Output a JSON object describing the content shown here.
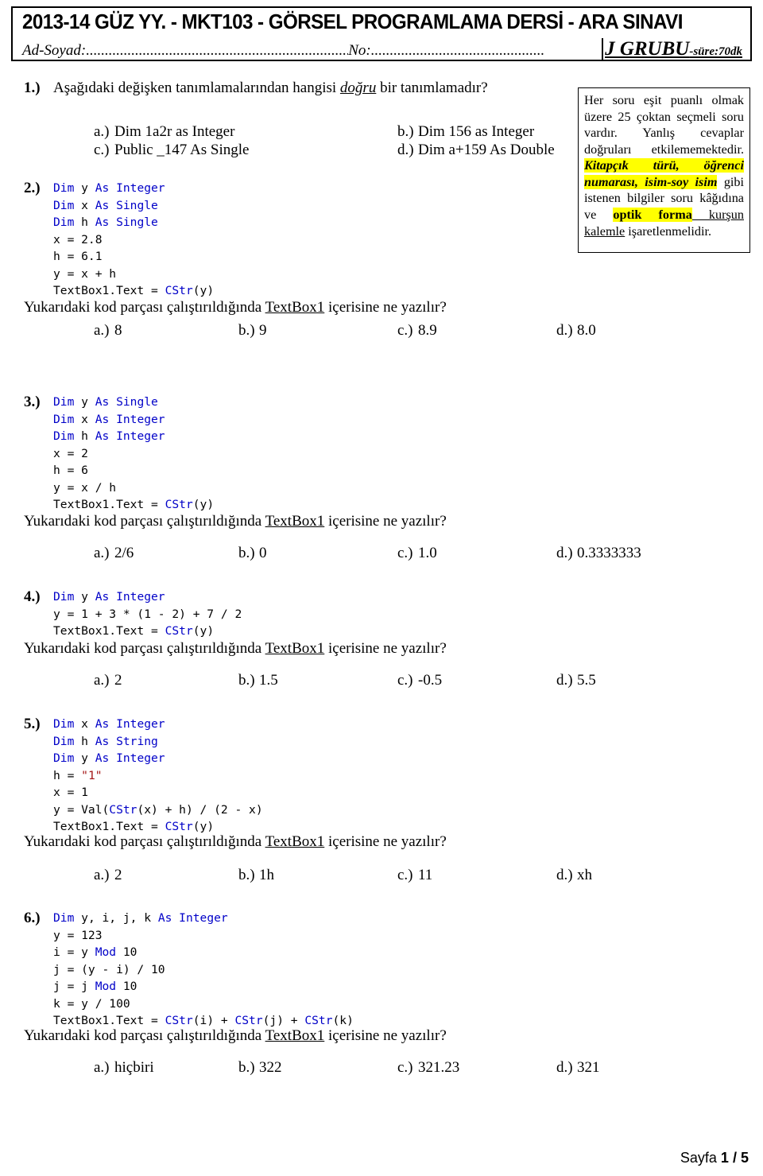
{
  "header": {
    "title": "2013-14 GÜZ YY. - MKT103 - GÖRSEL PROGRAMLAMA DERSİ - ARA SINAVI",
    "name_label": "Ad-Soyad:",
    "name_dots": "......................................................................",
    "no_label": "No:",
    "no_dots": "..............................................",
    "group": "J GRUBU",
    "duration": "-süre:70dk"
  },
  "info_box": {
    "line1": "Her soru eşit puanlı olmak üzere 25 çoktan seçmeli soru vardır.",
    "line2": "Yanlış cevaplar doğruları etkilememektedir.",
    "hl1": "Kitapçık türü, öğrenci numarası, isim-soy isim",
    "mid": " gibi istenen bilgiler soru kâğıdına ve ",
    "hl2": "optik forma",
    "underlined": " kurşun kalemle",
    "tail": " işaretlenmelidir."
  },
  "questions": [
    {
      "num": "1.)",
      "prompt_pre": "Aşağıdaki değişken tanımlamalarından hangisi ",
      "prompt_em": "doğru",
      "prompt_post": " bir tanımlamadır?",
      "options": [
        {
          "key": "a.)",
          "text": "Dim 1a2r as Integer"
        },
        {
          "key": "b.)",
          "text": "Dim 156 as Integer"
        },
        {
          "key": "c.)",
          "text": "Public _147 As Single"
        },
        {
          "key": "d.)",
          "text": "Dim a+159 As Double"
        }
      ]
    },
    {
      "num": "2.)",
      "code_lines": [
        [
          {
            "t": "Dim ",
            "c": "kw"
          },
          {
            "t": "y ",
            "c": "n"
          },
          {
            "t": "As Integer",
            "c": "kw"
          }
        ],
        [
          {
            "t": "Dim ",
            "c": "kw"
          },
          {
            "t": "x ",
            "c": "n"
          },
          {
            "t": "As Single",
            "c": "kw"
          }
        ],
        [
          {
            "t": "Dim ",
            "c": "kw"
          },
          {
            "t": "h ",
            "c": "n"
          },
          {
            "t": "As Single",
            "c": "kw"
          }
        ],
        [
          {
            "t": "x = 2.8",
            "c": "n"
          }
        ],
        [
          {
            "t": "h = 6.1",
            "c": "n"
          }
        ],
        [
          {
            "t": "y = x + h",
            "c": "n"
          }
        ],
        [
          {
            "t": "TextBox1.Text = ",
            "c": "n"
          },
          {
            "t": "CStr",
            "c": "kw"
          },
          {
            "t": "(y)",
            "c": "n"
          }
        ]
      ],
      "ask_pre": "Yukarıdaki kod parçası çalıştırıldığında ",
      "ask_em": "TextBox1",
      "ask_post": " içerisine ne yazılır?",
      "options": [
        {
          "key": "a.)",
          "text": "8"
        },
        {
          "key": "b.)",
          "text": "9"
        },
        {
          "key": "c.)",
          "text": "8.9"
        },
        {
          "key": "d.)",
          "text": "8.0"
        }
      ]
    },
    {
      "num": "3.)",
      "code_lines": [
        [
          {
            "t": "Dim ",
            "c": "kw"
          },
          {
            "t": "y ",
            "c": "n"
          },
          {
            "t": "As Single",
            "c": "kw"
          }
        ],
        [
          {
            "t": "Dim ",
            "c": "kw"
          },
          {
            "t": "x ",
            "c": "n"
          },
          {
            "t": "As Integer",
            "c": "kw"
          }
        ],
        [
          {
            "t": "Dim ",
            "c": "kw"
          },
          {
            "t": "h ",
            "c": "n"
          },
          {
            "t": "As Integer",
            "c": "kw"
          }
        ],
        [
          {
            "t": "x = 2",
            "c": "n"
          }
        ],
        [
          {
            "t": "h = 6",
            "c": "n"
          }
        ],
        [
          {
            "t": "y = x / h",
            "c": "n"
          }
        ],
        [
          {
            "t": "TextBox1.Text = ",
            "c": "n"
          },
          {
            "t": "CStr",
            "c": "kw"
          },
          {
            "t": "(y)",
            "c": "n"
          }
        ]
      ],
      "ask_pre": "Yukarıdaki kod parçası çalıştırıldığında ",
      "ask_em": "TextBox1",
      "ask_post": " içerisine ne yazılır?",
      "options": [
        {
          "key": "a.)",
          "text": "2/6"
        },
        {
          "key": "b.)",
          "text": "0"
        },
        {
          "key": "c.)",
          "text": "1.0"
        },
        {
          "key": "d.)",
          "text": "0.3333333"
        }
      ]
    },
    {
      "num": "4.)",
      "code_lines": [
        [
          {
            "t": "Dim ",
            "c": "kw"
          },
          {
            "t": "y ",
            "c": "n"
          },
          {
            "t": "As Integer",
            "c": "kw"
          }
        ],
        [
          {
            "t": "y = 1 + 3 * (1 - 2) + 7 / 2",
            "c": "n"
          }
        ],
        [
          {
            "t": "TextBox1.Text = ",
            "c": "n"
          },
          {
            "t": "CStr",
            "c": "kw"
          },
          {
            "t": "(y)",
            "c": "n"
          }
        ]
      ],
      "ask_pre": "Yukarıdaki kod parçası çalıştırıldığında ",
      "ask_em": "TextBox1",
      "ask_post": " içerisine ne yazılır?",
      "options": [
        {
          "key": "a.)",
          "text": "2"
        },
        {
          "key": "b.)",
          "text": "1.5"
        },
        {
          "key": "c.)",
          "text": "-0.5"
        },
        {
          "key": "d.)",
          "text": "5.5"
        }
      ]
    },
    {
      "num": "5.)",
      "code_lines": [
        [
          {
            "t": "Dim ",
            "c": "kw"
          },
          {
            "t": "x ",
            "c": "n"
          },
          {
            "t": "As Integer",
            "c": "kw"
          }
        ],
        [
          {
            "t": "Dim ",
            "c": "kw"
          },
          {
            "t": "h ",
            "c": "n"
          },
          {
            "t": "As String",
            "c": "kw"
          }
        ],
        [
          {
            "t": "Dim ",
            "c": "kw"
          },
          {
            "t": "y ",
            "c": "n"
          },
          {
            "t": "As Integer",
            "c": "kw"
          }
        ],
        [
          {
            "t": "h = ",
            "c": "n"
          },
          {
            "t": "\"1\"",
            "c": "str"
          }
        ],
        [
          {
            "t": "x = 1",
            "c": "n"
          }
        ],
        [
          {
            "t": "y = Val(",
            "c": "n"
          },
          {
            "t": "CStr",
            "c": "kw"
          },
          {
            "t": "(x) + h) / (2 - x)",
            "c": "n"
          }
        ],
        [
          {
            "t": "TextBox1.Text = ",
            "c": "n"
          },
          {
            "t": "CStr",
            "c": "kw"
          },
          {
            "t": "(y)",
            "c": "n"
          }
        ]
      ],
      "ask_pre": "Yukarıdaki kod parçası çalıştırıldığında ",
      "ask_em": "TextBox1",
      "ask_post": " içerisine ne yazılır?",
      "options": [
        {
          "key": "a.)",
          "text": "2"
        },
        {
          "key": "b.)",
          "text": "1h"
        },
        {
          "key": "c.)",
          "text": "11"
        },
        {
          "key": "d.)",
          "text": "xh"
        }
      ]
    },
    {
      "num": "6.)",
      "code_lines": [
        [
          {
            "t": "Dim ",
            "c": "kw"
          },
          {
            "t": "y, i, j, k ",
            "c": "n"
          },
          {
            "t": "As Integer",
            "c": "kw"
          }
        ],
        [
          {
            "t": "y = 123",
            "c": "n"
          }
        ],
        [
          {
            "t": "i = y ",
            "c": "n"
          },
          {
            "t": "Mod",
            "c": "kw"
          },
          {
            "t": " 10",
            "c": "n"
          }
        ],
        [
          {
            "t": "j = (y - i) / 10",
            "c": "n"
          }
        ],
        [
          {
            "t": "j = j ",
            "c": "n"
          },
          {
            "t": "Mod",
            "c": "kw"
          },
          {
            "t": " 10",
            "c": "n"
          }
        ],
        [
          {
            "t": "k = y / 100",
            "c": "n"
          }
        ],
        [
          {
            "t": "TextBox1.Text = ",
            "c": "n"
          },
          {
            "t": "CStr",
            "c": "kw"
          },
          {
            "t": "(i) + ",
            "c": "n"
          },
          {
            "t": "CStr",
            "c": "kw"
          },
          {
            "t": "(j) + ",
            "c": "n"
          },
          {
            "t": "CStr",
            "c": "kw"
          },
          {
            "t": "(k)",
            "c": "n"
          }
        ]
      ],
      "ask_pre": "Yukarıdaki kod parçası çalıştırıldığında ",
      "ask_em": "TextBox1",
      "ask_post": " içerisine ne yazılır?",
      "options": [
        {
          "key": "a.)",
          "text": "hiçbiri"
        },
        {
          "key": "b.)",
          "text": "322"
        },
        {
          "key": "c.)",
          "text": "321.23"
        },
        {
          "key": "d.)",
          "text": "321"
        }
      ]
    }
  ],
  "footer": {
    "label": "Sayfa",
    "page": "1",
    "sep": "/",
    "total": "5"
  },
  "colors": {
    "keyword": "#0000c8",
    "string": "#a31515",
    "highlight": "#ffff00"
  }
}
